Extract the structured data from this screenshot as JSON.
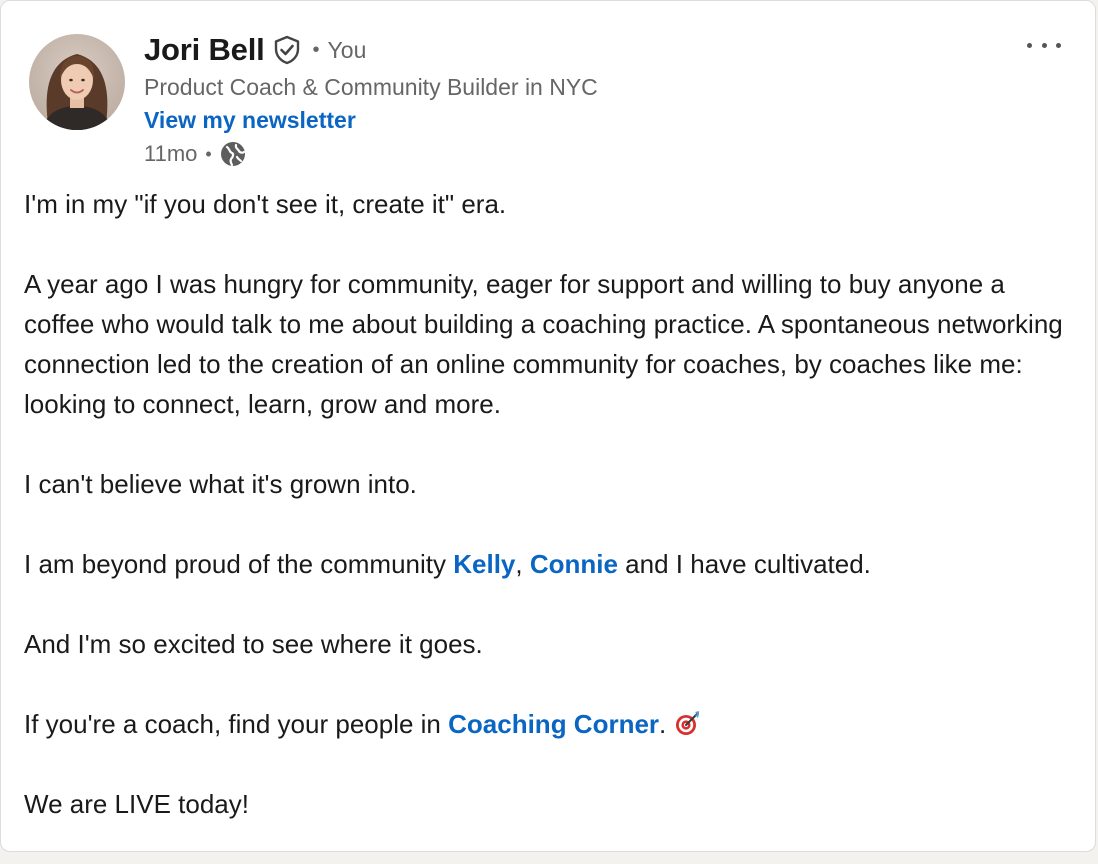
{
  "post": {
    "author": {
      "name": "Jori Bell",
      "relation": "You",
      "headline": "Product Coach & Community Builder in NYC",
      "newsletter_link": "View my newsletter",
      "icons": {
        "verified": "verified-shield-icon",
        "avatar": "avatar-photo"
      }
    },
    "meta": {
      "time": "11mo",
      "visibility_icon": "globe-icon"
    },
    "more_icon": "more-options-icon",
    "body": {
      "p1": "I'm in my \"if you don't see it, create it\" era.",
      "p2": "A year ago I was hungry for community, eager for support and willing to buy anyone a coffee who would talk to me about building a coaching practice. A spontaneous networking connection led to the creation of an online community for coaches, by coaches like me: looking to connect, learn, grow and more.",
      "p3": "I can't believe what it's grown into.",
      "p4": {
        "before": "I am beyond proud of the community ",
        "mention1": "Kelly",
        "sep": ", ",
        "mention2": "Connie",
        "after": " and I have cultivated."
      },
      "p5": "And I'm so excited to see where it goes.",
      "p6": {
        "before": "If you're a coach, find your people in ",
        "mention": "Coaching Corner",
        "after": ".",
        "emoji_icon": "direct-hit-icon"
      },
      "p7": "We are LIVE today!"
    },
    "colors": {
      "link": "#0a66c2",
      "secondary_text": "#666666",
      "primary_text": "#1a1a1a"
    }
  }
}
